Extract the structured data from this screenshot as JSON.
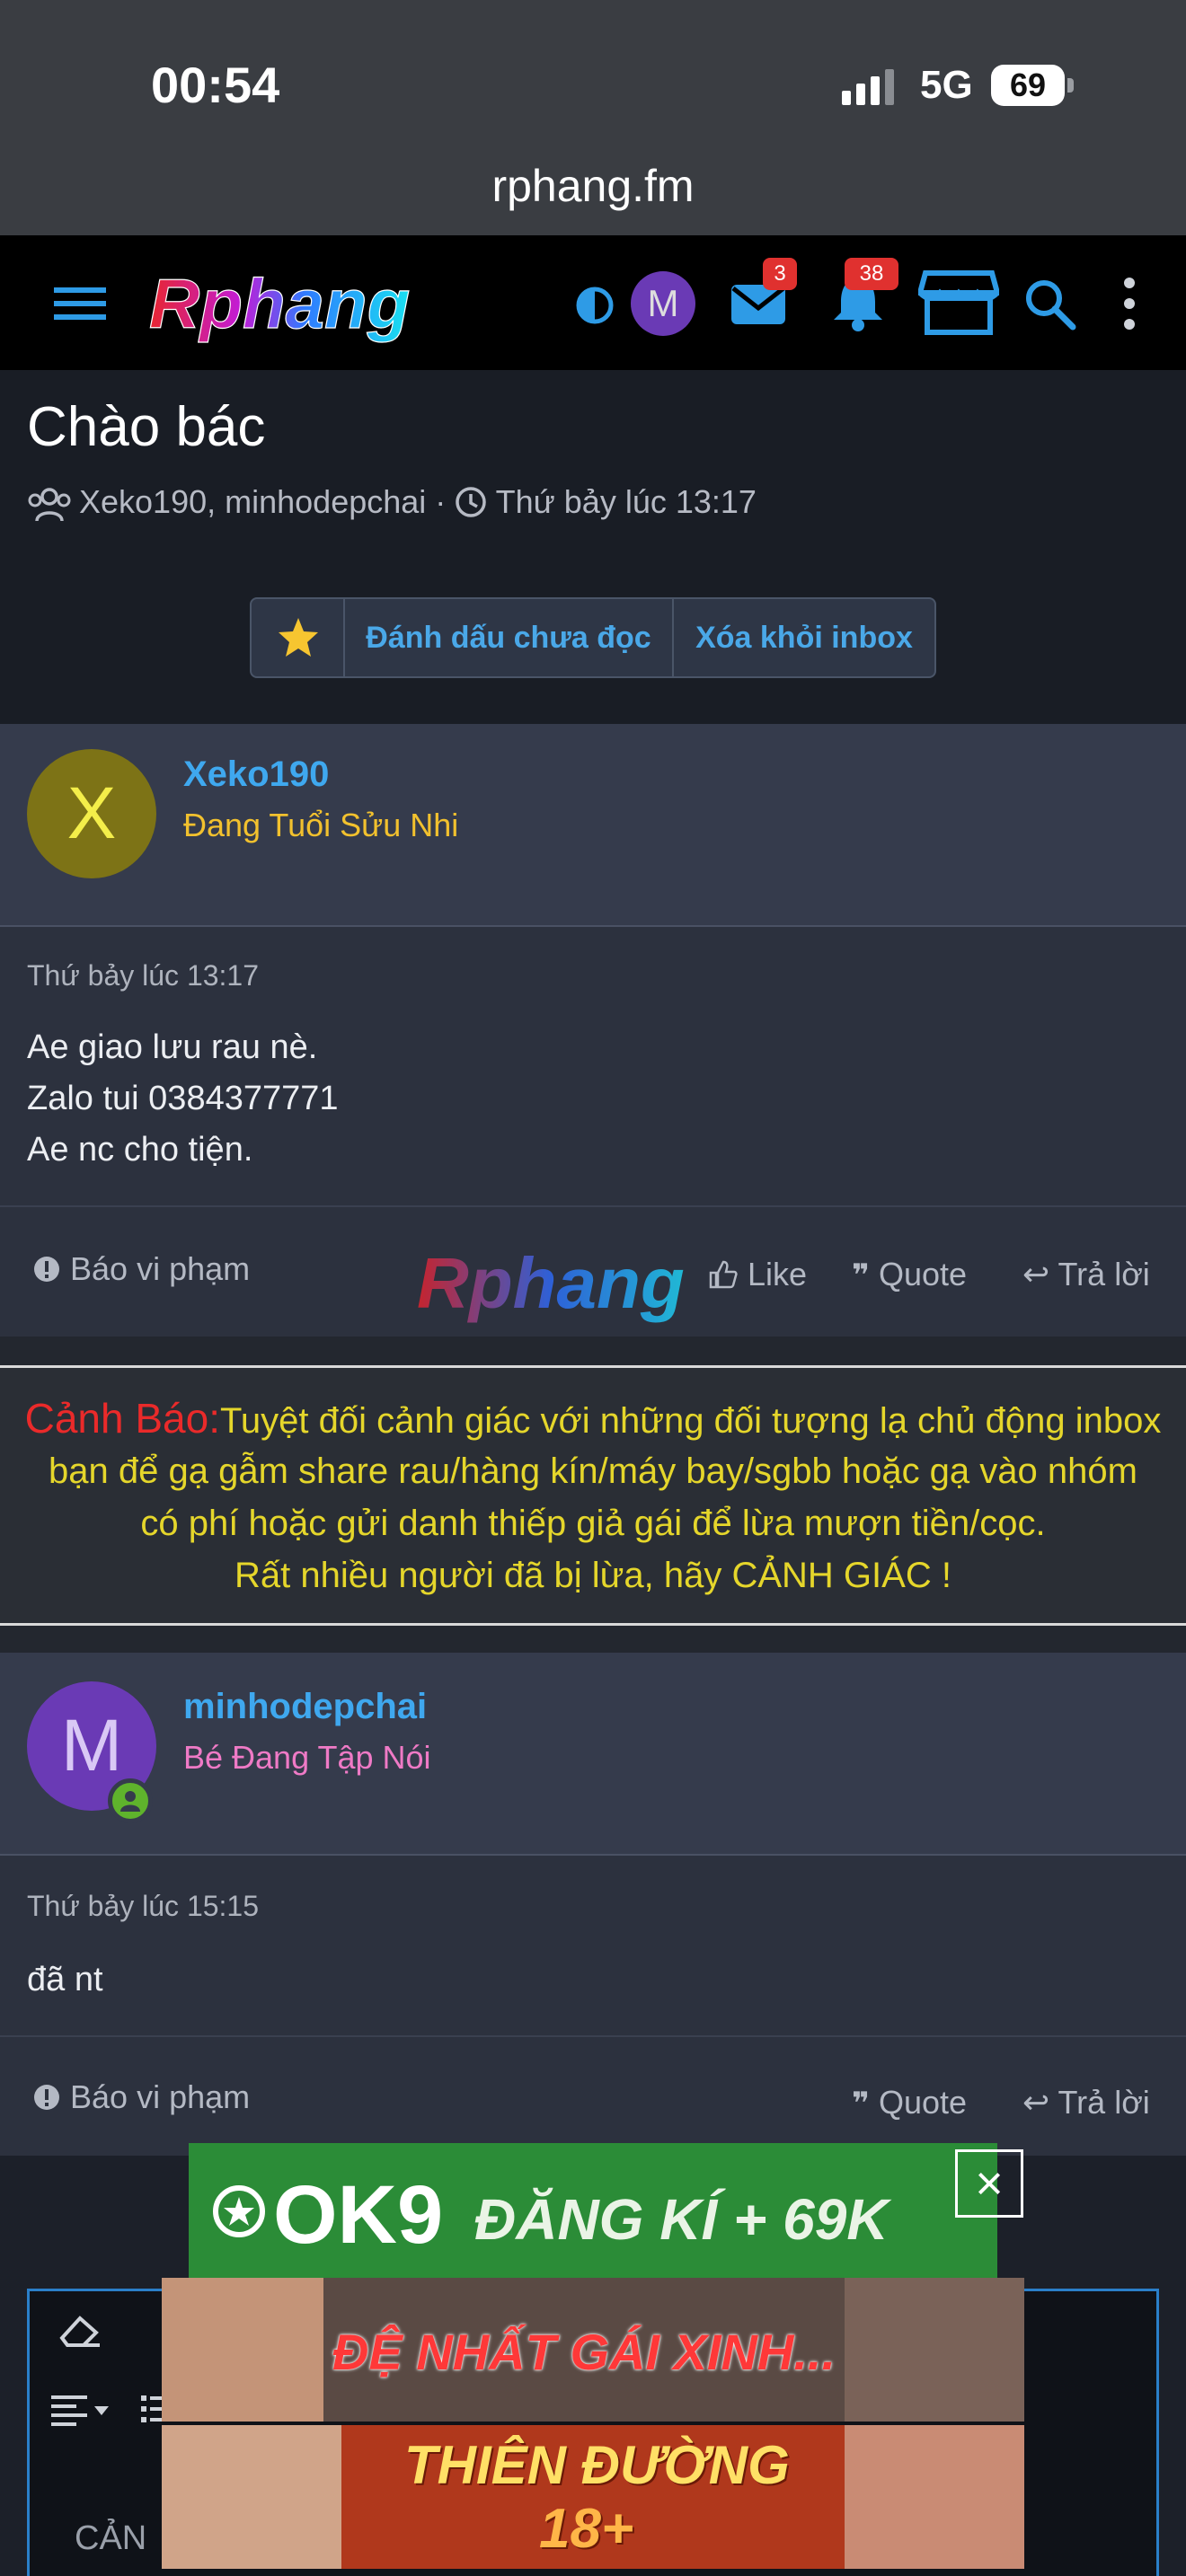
{
  "status_bar": {
    "time": "00:54",
    "network": "5G",
    "battery": "69"
  },
  "browser": {
    "url": "rphang.fm"
  },
  "nav": {
    "logo_text": "Rphang",
    "avatar_letter": "M",
    "mail_count": "3",
    "notification_count": "38"
  },
  "conversation": {
    "title": "Chào bác",
    "participants": "Xeko190, minhodepchai",
    "separator": "·",
    "date": "Thứ bảy lúc 13:17",
    "actions": {
      "mark_unread": "Đánh dấu chưa đọc",
      "remove_inbox": "Xóa khỏi inbox"
    }
  },
  "messages": [
    {
      "avatar_letter": "X",
      "avatar_color": "#7d7316",
      "username": "Xeko190",
      "user_title": "Đang Tuổi Sửu Nhi",
      "user_title_color": "#f2c12e",
      "time": "Thứ bảy lúc 13:17",
      "lines": [
        "Ae giao lưu rau nè.",
        "Zalo tui 0384377771",
        "Ae nc cho tiện."
      ],
      "report": "Báo vi phạm",
      "like": "Like",
      "quote": "Quote",
      "reply": "Trả lời"
    },
    {
      "avatar_letter": "M",
      "avatar_color": "#6a3ab5",
      "username": "minhodepchai",
      "user_title": "Bé Đang Tập Nói",
      "user_title_color": "#ef7ac6",
      "time": "Thứ bảy lúc 15:15",
      "lines": [
        "đã nt"
      ],
      "report": "Báo vi phạm",
      "quote": "Quote",
      "reply": "Trả lời"
    }
  ],
  "warning": {
    "label": "Cảnh Báo:",
    "line1": "Tuyệt đối cảnh giác với những đối tượng lạ chủ động inbox",
    "line2": "bạn để gạ gẫm share rau/hàng kín/máy bay/sgbb hoặc gạ vào nhóm",
    "line3": "có phí hoặc gửi danh thiếp giả gái để lừa mượn tiền/cọc.",
    "line4": "Rất nhiều người đã bị lừa, hãy CẢNH GIÁC !"
  },
  "editor": {
    "placeholder_partial": "CẢN"
  },
  "ads": [
    {
      "brand": "OK9",
      "text": "ĐĂNG KÍ + 69K"
    },
    {
      "text": "ĐỆ NHẤT GÁI XINH..."
    },
    {
      "text": "THIÊN ĐƯỜNG",
      "sub": "18+"
    }
  ],
  "colors": {
    "accent": "#3fa8ef",
    "background": "#23272f",
    "warning_text": "#e5d62b",
    "warning_label": "#ea2a2a",
    "badge": "#e0312f"
  }
}
